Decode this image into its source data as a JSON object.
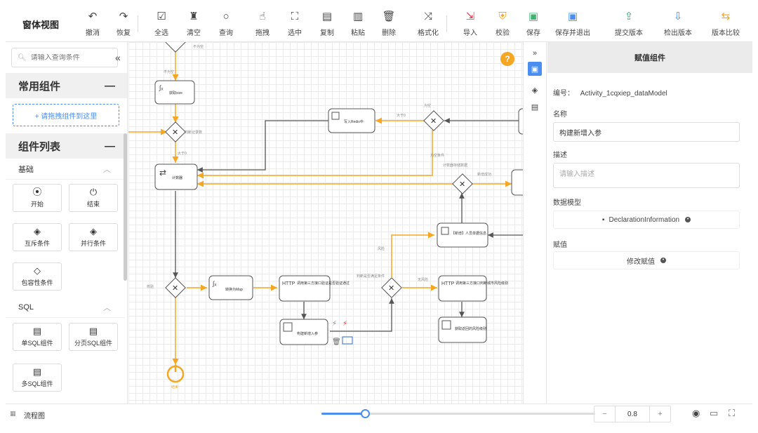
{
  "app": {
    "title": "窗体视图"
  },
  "toolbar": [
    {
      "id": "undo",
      "label": "撤消",
      "icon": "undo-icon"
    },
    {
      "id": "redo",
      "label": "恢复",
      "icon": "redo-icon"
    },
    {
      "id": "select-all",
      "label": "全选",
      "icon": "checkbox-icon"
    },
    {
      "id": "clear",
      "label": "清空",
      "icon": "broom-icon"
    },
    {
      "id": "query",
      "label": "查询",
      "icon": "search-icon"
    },
    {
      "id": "drag",
      "label": "拖拽",
      "icon": "hand-icon"
    },
    {
      "id": "select",
      "label": "选中",
      "icon": "crop-icon"
    },
    {
      "id": "copy",
      "label": "复制",
      "icon": "copy-icon"
    },
    {
      "id": "paste",
      "label": "粘贴",
      "icon": "paste-icon"
    },
    {
      "id": "delete",
      "label": "删除",
      "icon": "trash-icon"
    },
    {
      "id": "format",
      "label": "格式化",
      "icon": "format-icon"
    },
    {
      "id": "import",
      "label": "导入",
      "icon": "import-icon"
    },
    {
      "id": "validate",
      "label": "校验",
      "icon": "shield-icon"
    },
    {
      "id": "save",
      "label": "保存",
      "icon": "save-icon"
    },
    {
      "id": "save-exit",
      "label": "保存并退出",
      "icon": "save-exit-icon"
    },
    {
      "id": "submit",
      "label": "提交版本",
      "icon": "submit-icon"
    },
    {
      "id": "checkout",
      "label": "检出版本",
      "icon": "checkout-icon"
    },
    {
      "id": "compare",
      "label": "版本比较",
      "icon": "compare-icon"
    }
  ],
  "sidebar": {
    "search_placeholder": "请输入查询条件",
    "common_title": "常用组件",
    "drop_hint": "+ 请拖拽组件到这里",
    "list_title": "组件列表",
    "categories": [
      {
        "name": "基础",
        "items": [
          {
            "label": "开始",
            "icon": "power-circle-icon"
          },
          {
            "label": "结束",
            "icon": "power-icon"
          },
          {
            "label": "互斥条件",
            "icon": "exclusive-gateway-icon"
          },
          {
            "label": "并行条件",
            "icon": "parallel-gateway-icon"
          },
          {
            "label": "包容性条件",
            "icon": "inclusive-gateway-icon"
          }
        ]
      },
      {
        "name": "SQL",
        "items": [
          {
            "label": "单SQL组件",
            "icon": "sql-icon"
          },
          {
            "label": "分页SQL组件",
            "icon": "paged-sql-icon"
          },
          {
            "label": "多SQL组件",
            "icon": "multi-sql-icon"
          }
        ]
      }
    ]
  },
  "canvas": {
    "nodes": [
      {
        "label": "获取size"
      },
      {
        "label": "计数器"
      },
      {
        "label": "写入Redis中"
      },
      {
        "label": "转换为Map"
      },
      {
        "label": "调用第三方接口验证是否验证通过"
      },
      {
        "label": "构建新增入参"
      },
      {
        "label": "【新增】人员单据信息"
      },
      {
        "label": "调用第三方接口判断城市风险级别"
      },
      {
        "label": "获取返回的风险级别"
      }
    ],
    "edge_labels": [
      "不为空",
      "不为空",
      "判断记录数",
      "大于0",
      "为空",
      "为空条件",
      "计数器存储数据",
      "新增成功",
      "大于0",
      "判断是否满足条件",
      "风险",
      "无风险",
      "校验"
    ],
    "end_label": "结束"
  },
  "props": {
    "title": "赋值组件",
    "id_label": "编号：",
    "id_value": "Activity_1cqxiep_dataModel",
    "name_label": "名称",
    "name_value": "构建新增入参",
    "desc_label": "描述",
    "desc_placeholder": "请输入描述",
    "model_label": "数据模型",
    "model_value": "DeclarationInformation",
    "assign_label": "赋值",
    "assign_button": "修改赋值"
  },
  "footer": {
    "tab_label": "流程图",
    "zoom_value": "0.8",
    "zoom_fraction": 0.16,
    "minus": "−",
    "plus": "+"
  },
  "colors": {
    "accent": "#4a8ef0",
    "flow_active": "#f5a623",
    "flow_default": "#555555"
  }
}
